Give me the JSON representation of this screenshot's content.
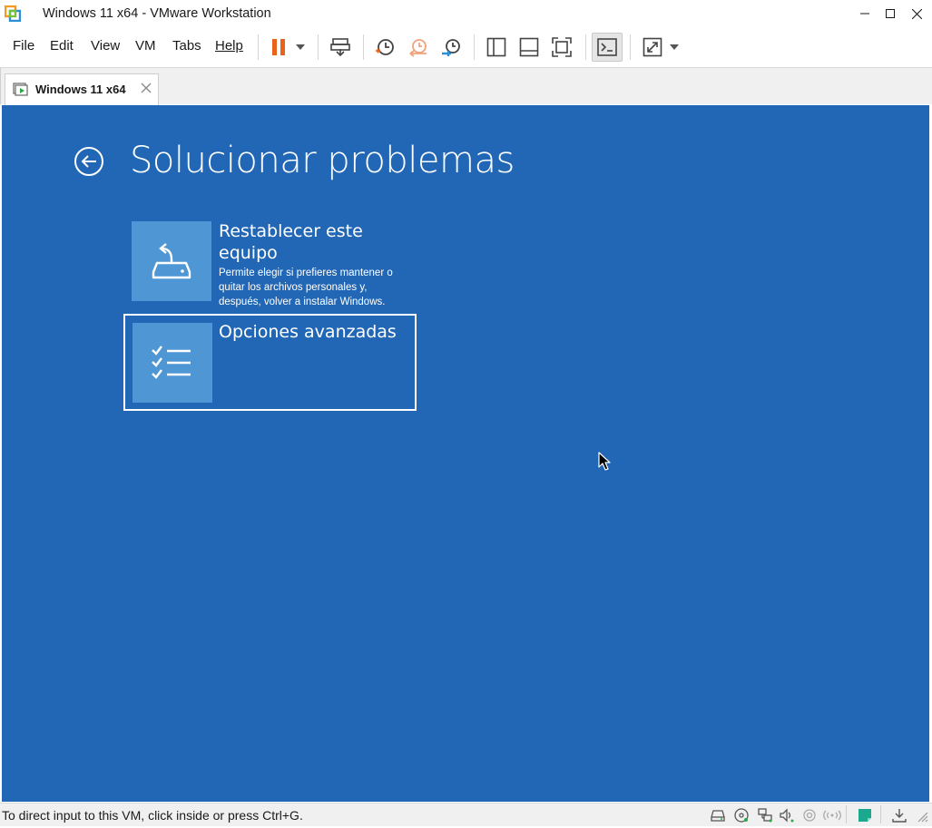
{
  "window": {
    "title": "Windows 11 x64 - VMware Workstation",
    "controls": [
      "minimize",
      "maximize",
      "close"
    ]
  },
  "menu": {
    "file": "File",
    "edit": "Edit",
    "view": "View",
    "vm": "VM",
    "tabs": "Tabs",
    "help": "Help"
  },
  "toolbar": {
    "icons": [
      "pause-icon",
      "dropdown-arrow-icon",
      "send-ctrl-alt-del-icon",
      "take-snapshot-icon",
      "revert-snapshot-icon",
      "snapshot-manager-icon",
      "show-library-icon",
      "thumbnail-bar-icon",
      "full-screen-icon",
      "console-view-icon",
      "stretch-guest-icon",
      "dropdown-arrow-icon"
    ],
    "pause_color": "#e8641b",
    "snapshot_accent": "#f2a27a"
  },
  "tab": {
    "label": "Windows 11 x64"
  },
  "vm": {
    "background": "#2167b6",
    "tile_color": "#4f97d4",
    "page_title": "Solucionar problemas",
    "options": [
      {
        "title": "Restablecer este equipo",
        "description": "Permite elegir si prefieres mantener o quitar los archivos personales y, después, volver a instalar Windows.",
        "icon": "reset-pc-icon"
      },
      {
        "title": "Opciones avanzadas",
        "icon": "advanced-options-icon",
        "selected": true
      }
    ]
  },
  "statusbar": {
    "text": "To direct input to this VM, click inside or press Ctrl+G.",
    "device_icons": [
      "hard-disk-icon",
      "cd-dvd-icon",
      "network-adapter-icon",
      "sound-card-icon",
      "usb-icon",
      "tpm-icon",
      "message-log-icon",
      "download-icon",
      "resize-grip-icon"
    ],
    "message_icon_color": "#1aa88f"
  }
}
